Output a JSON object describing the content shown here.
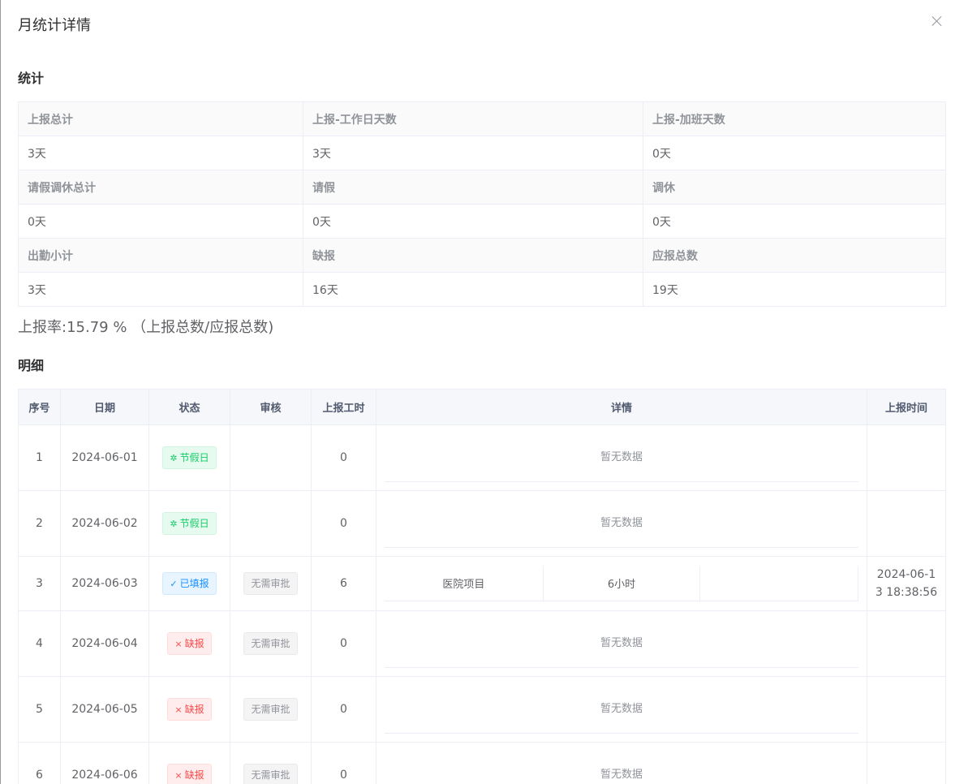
{
  "dialog": {
    "title": "月统计详情"
  },
  "stats": {
    "heading": "统计",
    "labels": [
      "上报总计",
      "上报-工作日天数",
      "上报-加班天数",
      "请假调休总计",
      "请假",
      "调休",
      "出勤小计",
      "缺报",
      "应报总数"
    ],
    "values": [
      "3天",
      "3天",
      "0天",
      "0天",
      "0天",
      "0天",
      "3天",
      "16天",
      "19天"
    ]
  },
  "rate_text": "上报率:15.79 % （上报总数/应报总数)",
  "detail": {
    "heading": "明细",
    "columns": [
      "序号",
      "日期",
      "状态",
      "审核",
      "上报工时",
      "详情",
      "上报时间"
    ],
    "empty_text": "暂无数据",
    "rows": [
      {
        "no": "1",
        "date": "2024-06-01",
        "status": "节假日",
        "status_icon": "sparkle-icon",
        "review": "",
        "hours": "0",
        "detail": null,
        "time": ""
      },
      {
        "no": "2",
        "date": "2024-06-02",
        "status": "节假日",
        "status_icon": "sparkle-icon",
        "review": "",
        "hours": "0",
        "detail": null,
        "time": ""
      },
      {
        "no": "3",
        "date": "2024-06-03",
        "status": "已填报",
        "status_icon": "check-icon",
        "review": "无需审批",
        "hours": "6",
        "detail": {
          "project": "医院项目",
          "duration": "6小时",
          "note": ""
        },
        "time": "2024-06-13 18:38:56"
      },
      {
        "no": "4",
        "date": "2024-06-04",
        "status": "缺报",
        "status_icon": "cross-icon",
        "review": "无需审批",
        "hours": "0",
        "detail": null,
        "time": ""
      },
      {
        "no": "5",
        "date": "2024-06-05",
        "status": "缺报",
        "status_icon": "cross-icon",
        "review": "无需审批",
        "hours": "0",
        "detail": null,
        "time": ""
      },
      {
        "no": "6",
        "date": "2024-06-06",
        "status": "缺报",
        "status_icon": "cross-icon",
        "review": "无需审批",
        "hours": "0",
        "detail": null,
        "time": ""
      }
    ]
  },
  "colors": {
    "holiday": "#13ce66",
    "filled": "#1890ff",
    "missing": "#ff4949",
    "review": "#909399"
  }
}
